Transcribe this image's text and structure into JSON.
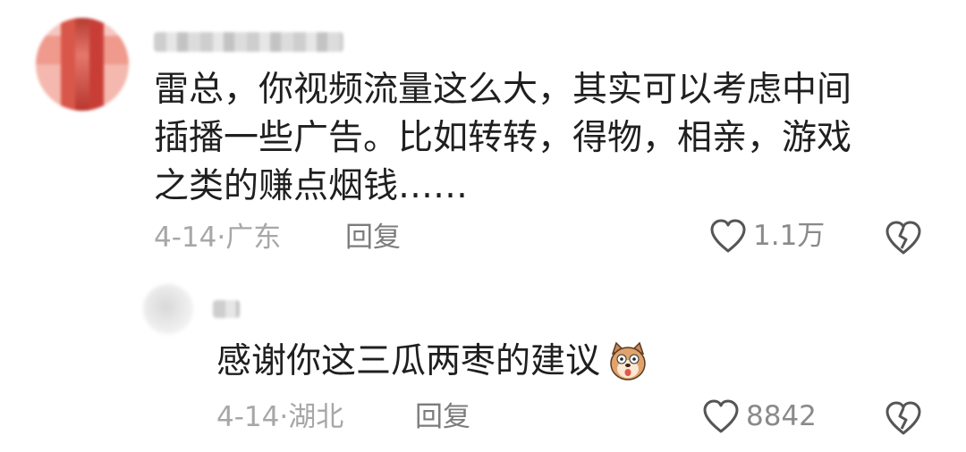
{
  "comments": [
    {
      "text_lines": [
        "雷总，你视频流量这么大，其实可以考虑中间",
        "插播一些广告。比如转转，得物，相亲，游戏",
        "之类的赚点烟钱……"
      ],
      "meta": "4-14·广东",
      "reply_label": "回复",
      "likes": "1.1万"
    },
    {
      "text": "感谢你这三瓜两枣的建议",
      "meta": "4-14·湖北",
      "reply_label": "回复",
      "likes": "8842"
    }
  ],
  "icons": {
    "like": "heart-outline-icon",
    "dislike": "broken-heart-icon",
    "emoji": "dog-face-emoji-icon"
  },
  "colors": {
    "text": "#1f1f1f",
    "meta": "#a7a7a7",
    "reply": "#7c7c7c"
  }
}
